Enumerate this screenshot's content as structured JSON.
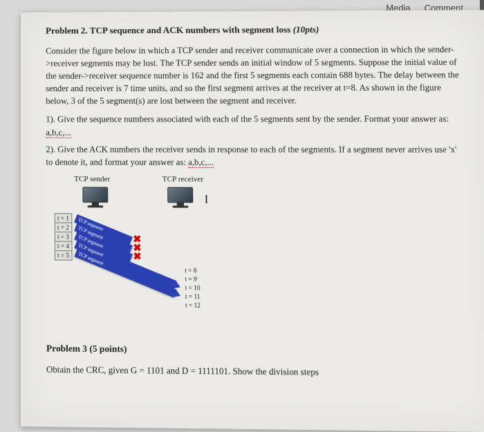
{
  "tabs": {
    "media": "Media",
    "comment": "Comment"
  },
  "problem2": {
    "title": "Problem 2. TCP sequence and ACK numbers with segment loss ",
    "points": "(10pts)",
    "body": "Consider the figure below in which a TCP sender and receiver communicate over a connection in which the sender->receiver segments may be lost. The TCP sender sends an initial window of 5 segments. Suppose the initial value of the sender->receiver sequence number is 162 and the first 5 segments each contain 688 bytes. The delay between the sender and receiver is 7 time units, and so the first segment arrives at the receiver at t=8. As shown in the figure below, 3 of the 5 segment(s) are lost between the segment and receiver.",
    "q1_lead": "1). Give the sequence numbers associated with each of the 5 segments sent by the sender. Format your answer as: ",
    "q1_fmt": "a,b,c,...",
    "q2_lead": "2). Give the ACK numbers the receiver sends in response to each of the segments. If a segment never arrives use 'x' to denote it, and format your answer as: ",
    "q2_fmt": "a,b,c,..."
  },
  "diagram": {
    "sender": "TCP sender",
    "receiver": "TCP receiver",
    "I": "I",
    "sender_times": [
      "t = 1",
      "t = 2",
      "t = 3",
      "t = 4",
      "t = 5"
    ],
    "recv_times": [
      "t = 8",
      "t = 9",
      "t = 10",
      "t = 11",
      "t = 12"
    ],
    "segments": [
      {
        "label": "TCP segment",
        "lost": true
      },
      {
        "label": "TCP segment",
        "lost": true
      },
      {
        "label": "TCP segment",
        "lost": true
      },
      {
        "label": "TCP segment",
        "lost": false
      },
      {
        "label": "TCP segment",
        "lost": false
      }
    ]
  },
  "problem3": {
    "title": "Problem 3 (5 points)",
    "body": "Obtain the CRC, given G = 1101 and D = 1111101. Show the division steps"
  }
}
